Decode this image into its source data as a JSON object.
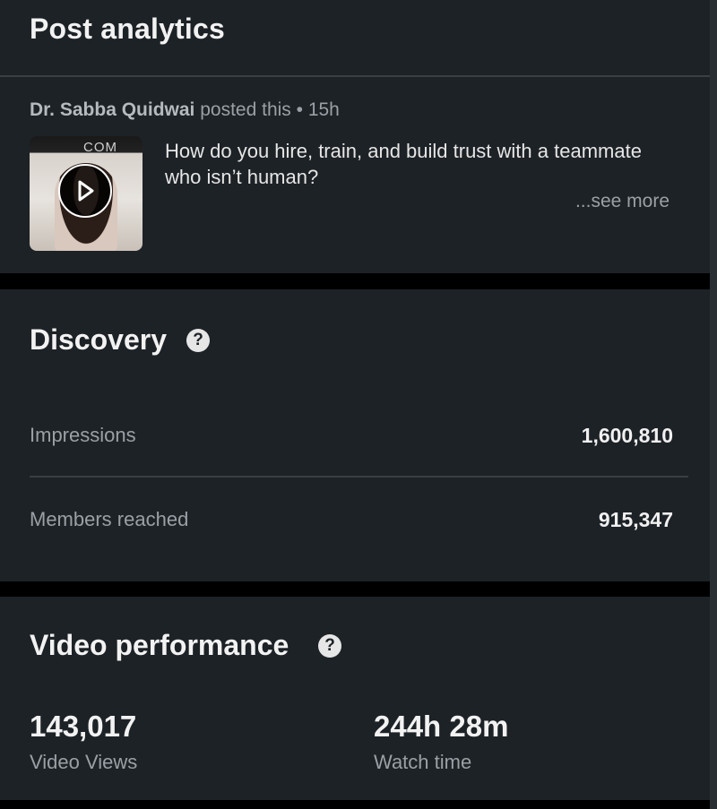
{
  "header": {
    "title": "Post analytics"
  },
  "post": {
    "author": "Dr. Sabba Quidwai",
    "action": " posted this",
    "separator": " • ",
    "time": "15h",
    "text": "How do you hire, train, and build trust with a teammate who isn’t human?",
    "see_more": "...see more",
    "thumbnail_caption": "COM",
    "play_icon": "play-icon"
  },
  "discovery": {
    "title": "Discovery",
    "help_icon": "?",
    "metrics": [
      {
        "label": "Impressions",
        "value": "1,600,810"
      },
      {
        "label": "Members reached",
        "value": "915,347"
      }
    ]
  },
  "video_performance": {
    "title": "Video performance",
    "help_icon": "?",
    "stats": [
      {
        "value": "143,017",
        "label": "Video Views"
      },
      {
        "value": "244h 28m",
        "label": "Watch time"
      }
    ]
  },
  "colors": {
    "background": "#000000",
    "card": "#1d2226",
    "text_primary": "#f2f2f2",
    "text_secondary": "#9aa0a6",
    "divider": "#3a3f44"
  }
}
